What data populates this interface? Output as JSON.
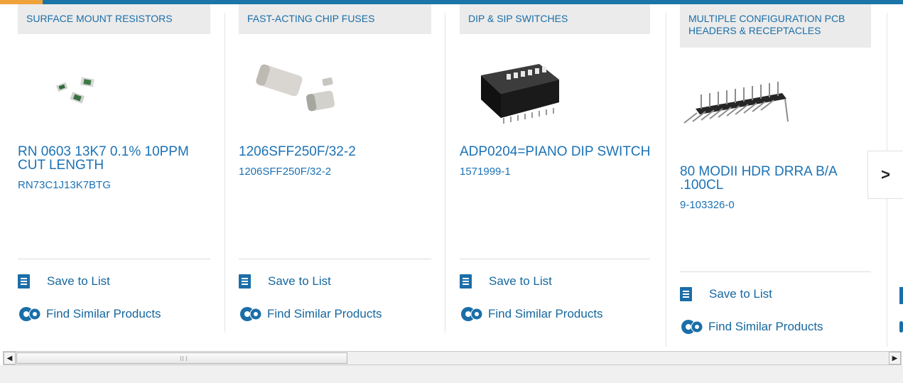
{
  "colors": {
    "brand_blue": "#1b75a8",
    "accent_orange": "#f1a33b",
    "link_blue": "#1c72b5",
    "category_bg": "#ebebeb"
  },
  "products": [
    {
      "category": "SURFACE MOUNT RESISTORS",
      "title": "RN 0603 13K7 0.1% 10PPM CUT LENGTH",
      "part_number": "RN73C1J13K7BTG",
      "save_label": "Save to List",
      "similar_label": "Find Similar Products"
    },
    {
      "category": "FAST-ACTING CHIP FUSES",
      "title": "1206SFF250F/32-2",
      "part_number": "1206SFF250F/32-2",
      "save_label": "Save to List",
      "similar_label": "Find Similar Products"
    },
    {
      "category": "DIP & SIP SWITCHES",
      "title": "ADP0204=PIANO DIP SWITCH",
      "part_number": "1571999-1",
      "save_label": "Save to List",
      "similar_label": "Find Similar Products"
    },
    {
      "category": "MULTIPLE CONFIGURATION PCB HEADERS & RECEPTACLES",
      "title": "80 MODII HDR DRRA B/A .100CL",
      "part_number": "9-103326-0",
      "save_label": "Save to List",
      "similar_label": "Find Similar Products"
    }
  ],
  "carousel": {
    "next_icon": "chevron-right-icon",
    "next_glyph": ">"
  },
  "scrollbar": {
    "left_arrow": "◀",
    "right_arrow": "▶"
  }
}
